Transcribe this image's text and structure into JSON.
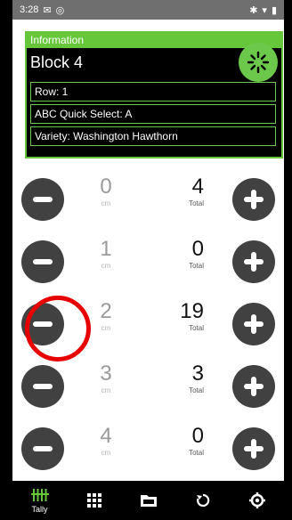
{
  "status_bar": {
    "time": "3:28",
    "left_icons": [
      "notification-icon",
      "location-icon"
    ],
    "right_icons": [
      "bluetooth-icon",
      "wifi-icon",
      "battery-icon"
    ]
  },
  "info_panel": {
    "header": "Information",
    "title": "Block 4",
    "row": "Row: 1",
    "quick_select": "ABC Quick Select: A",
    "variety": "Variety: Washington Hawthorn"
  },
  "unit_label": "cm",
  "total_label": "Total",
  "tally_rows": [
    {
      "size": "0",
      "total": "4"
    },
    {
      "size": "1",
      "total": "0"
    },
    {
      "size": "2",
      "total": "19"
    },
    {
      "size": "3",
      "total": "3"
    },
    {
      "size": "4",
      "total": "0"
    }
  ],
  "bottom_nav": [
    {
      "label": "Tally",
      "icon": "tally-icon",
      "active": true
    },
    {
      "label": "",
      "icon": "grid-icon"
    },
    {
      "label": "",
      "icon": "folder-icon"
    },
    {
      "label": "",
      "icon": "refresh-icon"
    },
    {
      "label": "",
      "icon": "settings-icon"
    }
  ],
  "colors": {
    "accent_green": "#66c73a",
    "button_gray": "#414141",
    "highlight_red": "#e60000"
  }
}
